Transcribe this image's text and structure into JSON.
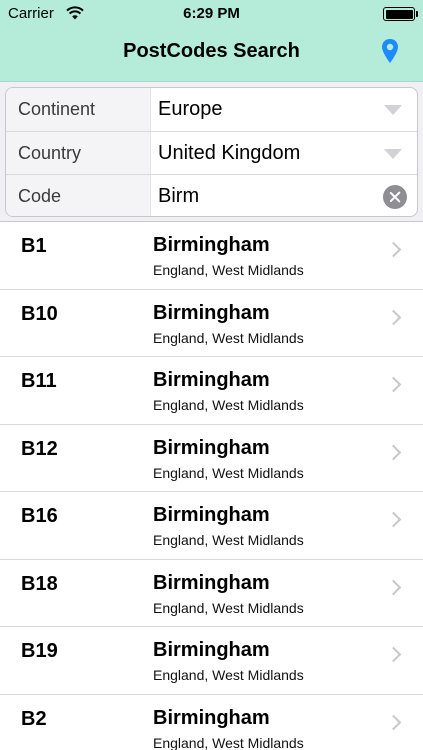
{
  "status_bar": {
    "carrier": "Carrier",
    "time": "6:29 PM"
  },
  "nav": {
    "title": "PostCodes Search",
    "location_icon": "location-pin-icon",
    "accent_color": "#1a8cff",
    "background_color": "#b4ecd9"
  },
  "form": {
    "continent": {
      "label": "Continent",
      "value": "Europe"
    },
    "country": {
      "label": "Country",
      "value": "United Kingdom"
    },
    "code": {
      "label": "Code",
      "value": "Birm"
    }
  },
  "results": [
    {
      "code": "B1",
      "city": "Birmingham",
      "region": "England, West Midlands"
    },
    {
      "code": "B10",
      "city": "Birmingham",
      "region": "England, West Midlands"
    },
    {
      "code": "B11",
      "city": "Birmingham",
      "region": "England, West Midlands"
    },
    {
      "code": "B12",
      "city": "Birmingham",
      "region": "England, West Midlands"
    },
    {
      "code": "B16",
      "city": "Birmingham",
      "region": "England, West Midlands"
    },
    {
      "code": "B18",
      "city": "Birmingham",
      "region": "England, West Midlands"
    },
    {
      "code": "B19",
      "city": "Birmingham",
      "region": "England, West Midlands"
    },
    {
      "code": "B2",
      "city": "Birmingham",
      "region": "England, West Midlands"
    }
  ]
}
